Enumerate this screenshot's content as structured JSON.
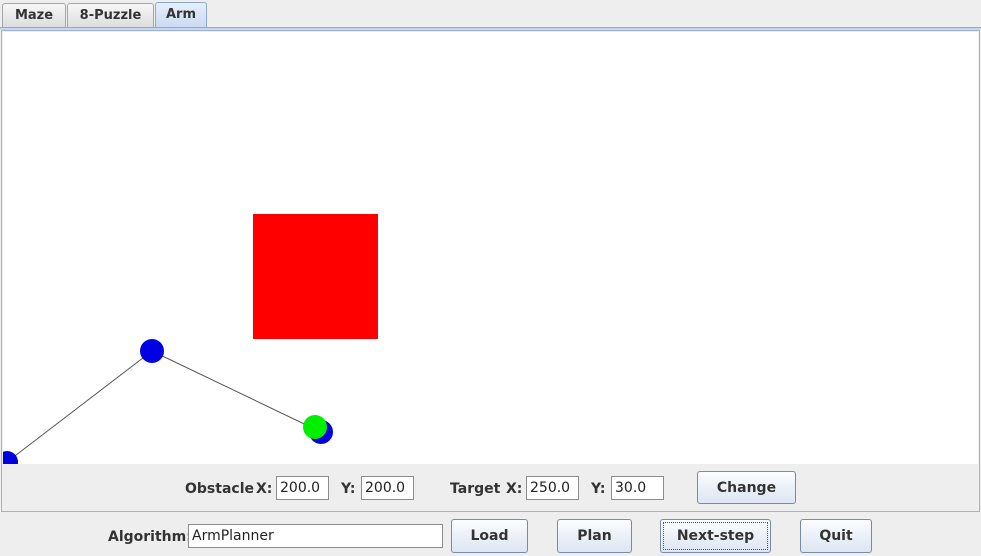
{
  "tabs": [
    {
      "label": "Maze",
      "selected": false
    },
    {
      "label": "8-Puzzle",
      "selected": false
    },
    {
      "label": "Arm",
      "selected": true
    }
  ],
  "scene": {
    "obstacle_color": "#ff0000",
    "joint_color": "#0000e0",
    "target_color": "#00ee00",
    "link_color": "#555555"
  },
  "controls": {
    "obstacle_label": "Obstacle",
    "obstacle_x_label": "X:",
    "obstacle_x": "200.0",
    "obstacle_y_label": "Y:",
    "obstacle_y": "200.0",
    "target_label": "Target",
    "target_x_label": "X:",
    "target_x": "250.0",
    "target_y_label": "Y:",
    "target_y": "30.0",
    "change_label": "Change"
  },
  "bottom": {
    "algorithm_label": "Algorithm:",
    "algorithm_value": "ArmPlanner",
    "load_label": "Load",
    "plan_label": "Plan",
    "next_step_label": "Next-step",
    "quit_label": "Quit"
  }
}
